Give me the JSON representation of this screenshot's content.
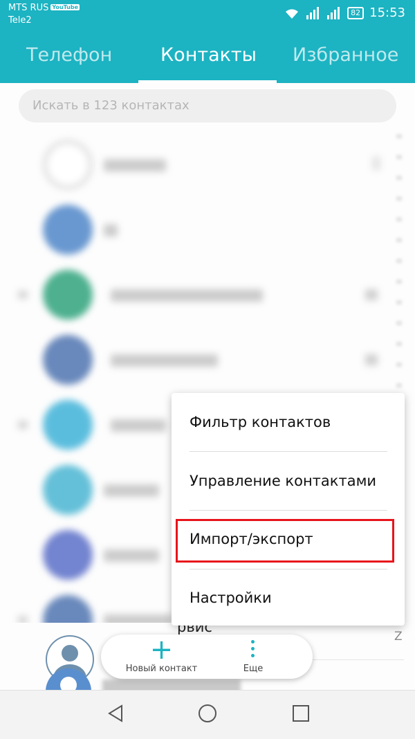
{
  "status_bar": {
    "carrier_primary": "MTS RUS",
    "carrier_badge": "YouTube",
    "carrier_secondary": "Tele2",
    "battery": "82",
    "time": "15:53"
  },
  "tabs": [
    {
      "label": "Телефон",
      "active": false
    },
    {
      "label": "Контакты",
      "active": true
    },
    {
      "label": "Избранное",
      "active": false
    }
  ],
  "search": {
    "placeholder": "Искать в 123 контактах"
  },
  "list": {
    "partial_row_text": "рвис",
    "index_letter": "Z"
  },
  "menu": {
    "items": [
      {
        "label": "Фильтр контактов"
      },
      {
        "label": "Управление контактами"
      },
      {
        "label": "Импорт/экспорт",
        "highlighted": true
      },
      {
        "label": "Настройки"
      }
    ]
  },
  "fab": {
    "new_contact_label": "Новый контакт",
    "more_label": "Еще"
  },
  "colors": {
    "accent": "#1cb3c2",
    "highlight_frame": "#e8141b"
  },
  "icons": {
    "wifi": "wifi-icon",
    "signal": "signal-icon",
    "battery": "battery-icon",
    "add": "plus-icon",
    "more": "more-vertical-icon",
    "back": "back-triangle-icon",
    "home": "home-circle-icon",
    "recents": "recents-square-icon"
  }
}
